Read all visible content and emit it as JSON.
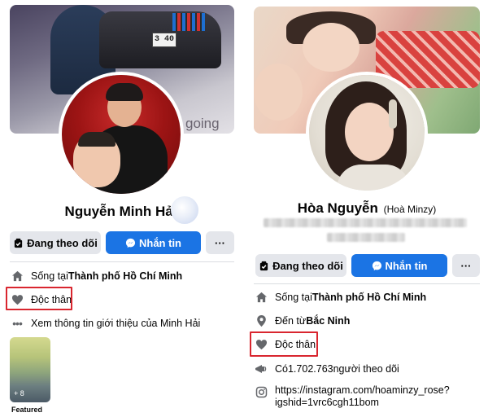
{
  "left": {
    "cover_text": "going",
    "cover_plate": "3 40",
    "name": "Nguyễn Minh Hải",
    "buttons": {
      "following": "Đang theo dõi",
      "message": "Nhắn tin",
      "more": "···"
    },
    "info": {
      "lives_prefix": "Sống tại ",
      "lives_place": "Thành phố Hồ Chí Minh",
      "relationship": "Độc thân",
      "see_more": "Xem thông tin giới thiệu của Minh Hải"
    },
    "featured": {
      "count": "+ 8",
      "label": "Featured"
    }
  },
  "right": {
    "name": "Hòa Nguyễn",
    "alt_name": "(Hoà Minzy)",
    "buttons": {
      "following": "Đang theo dõi",
      "message": "Nhắn tin",
      "more": "···"
    },
    "info": {
      "lives_prefix": "Sống tại ",
      "lives_place": "Thành phố Hồ Chí Minh",
      "from_prefix": "Đến từ ",
      "from_place": "Bắc Ninh",
      "relationship": "Độc thân",
      "followers_prefix": "Có ",
      "followers_count": "1.702.763",
      "followers_suffix": " người theo dõi",
      "instagram_line1": "https://instagram.com/hoaminzy_rose?",
      "instagram_line2": "igshid=1vrc6cgh11bom"
    }
  },
  "colors": {
    "messenger_blue": "#1b74e4",
    "button_gray": "#e4e6eb",
    "highlight_red": "#d9262f"
  }
}
